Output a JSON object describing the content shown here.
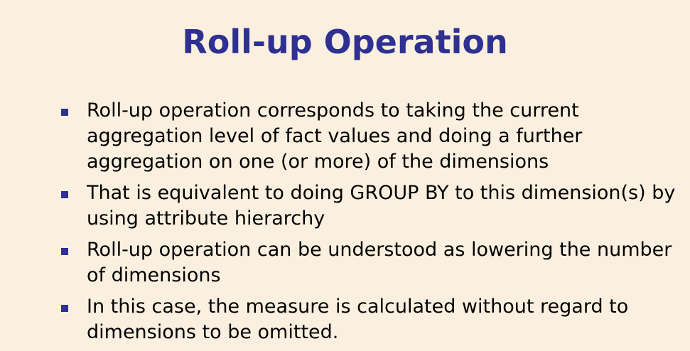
{
  "slide": {
    "title": "Roll-up Operation",
    "accent_color": "#2e3192",
    "background_color": "#fbf0df",
    "bullets": [
      {
        "text": "Roll-up operation corresponds to taking the current aggregation level of fact values and doing a further aggregation on one (or more) of the dimensions"
      },
      {
        "text": "That is equivalent to doing GROUP BY to this dimension(s) by using attribute hierarchy"
      },
      {
        "text": "Roll-up operation can be understood as lowering the number of dimensions"
      },
      {
        "text": "In this case, the measure is calculated without regard to dimensions to be omitted."
      }
    ]
  }
}
